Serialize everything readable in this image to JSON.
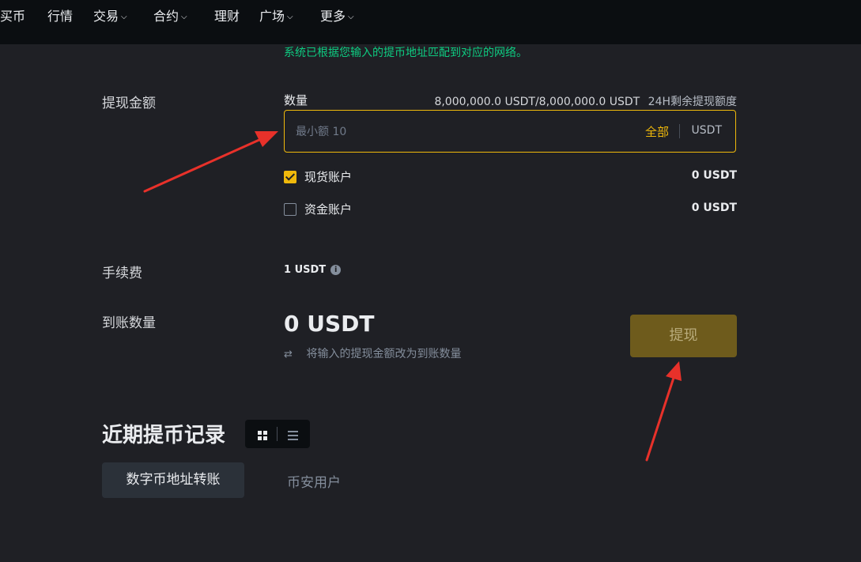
{
  "nav": {
    "items": [
      {
        "label": "买币",
        "has_menu": false
      },
      {
        "label": "行情",
        "has_menu": false
      },
      {
        "label": "交易",
        "has_menu": true
      },
      {
        "label": "合约",
        "has_menu": true
      },
      {
        "label": "理财",
        "has_menu": false
      },
      {
        "label": "广场",
        "has_menu": true
      },
      {
        "label": "更多",
        "has_menu": true
      }
    ]
  },
  "network_note": "系统已根据您输入的提币地址匹配到对应的网络。",
  "withdraw_amount": {
    "section_label": "提现金额",
    "quantity_label": "数量",
    "quota_amount": "8,000,000.0 USDT/8,000,000.0 USDT",
    "quota_label": "24H剩余提现额度",
    "input_value": "",
    "input_placeholder": "最小额 10",
    "max_label": "全部",
    "unit": "USDT"
  },
  "accounts": [
    {
      "label": "现货账户",
      "balance": "0 USDT",
      "checked": true
    },
    {
      "label": "资金账户",
      "balance": "0 USDT",
      "checked": false
    }
  ],
  "fee": {
    "label": "手续费",
    "value": "1 USDT",
    "icon": "info-icon"
  },
  "receive": {
    "label": "到账数量",
    "amount": "0 USDT",
    "swap_text": "将输入的提现金额改为到账数量",
    "swap_icon": "swap-arrows-icon"
  },
  "withdraw_button": "提现",
  "records": {
    "title": "近期提币记录",
    "tabs": [
      {
        "label": "数字币地址转账",
        "active": true
      },
      {
        "label": "币安用户",
        "active": false
      }
    ]
  },
  "colors": {
    "accent": "#f0b90b",
    "success_text": "#0ecb81",
    "annotation_arrow": "#e8312a",
    "background": "#1f2025",
    "topbar": "#0b0e11"
  }
}
